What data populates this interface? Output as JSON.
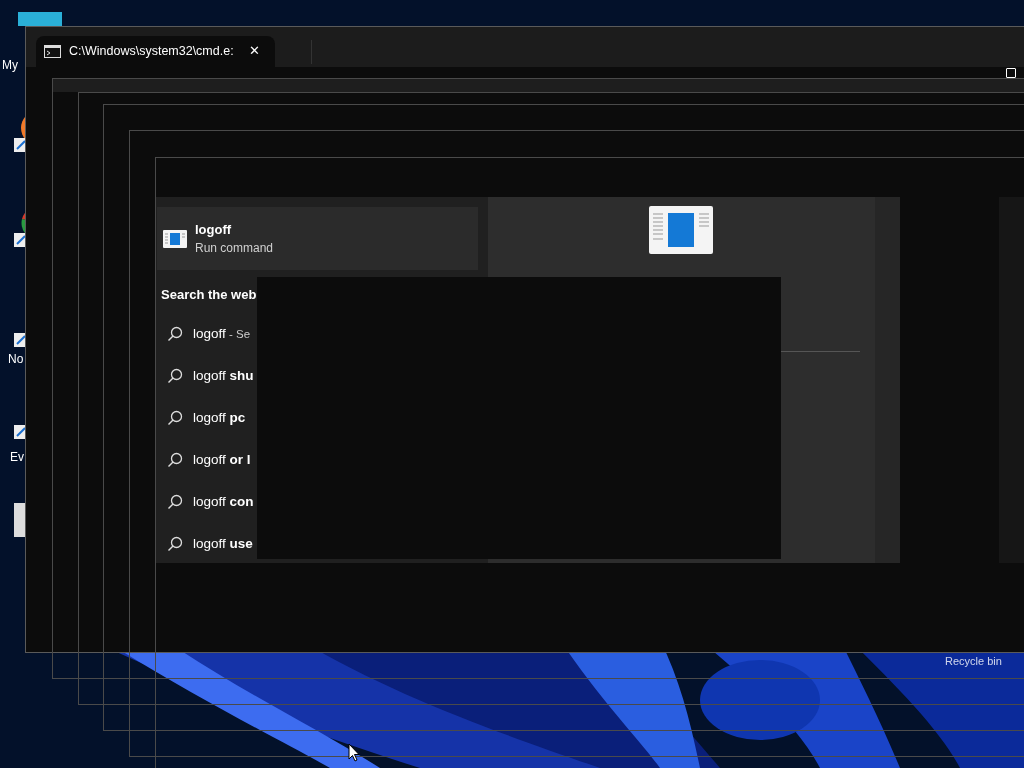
{
  "desktop_icons": [
    {
      "kind": "monitor",
      "label": "My"
    },
    {
      "kind": "orange"
    },
    {
      "kind": "chrome"
    },
    {
      "kind": "notepad",
      "label": "No"
    },
    {
      "kind": "shortcut",
      "label": "Ev"
    },
    {
      "kind": "blank"
    }
  ],
  "recycle_bin": {
    "label": "Recycle bin"
  },
  "window": {
    "tab_title": "C:\\Windows\\system32\\cmd.e:",
    "close": "✕"
  },
  "best_match": {
    "title": "logoff",
    "subtitle": "Run command"
  },
  "web_section": {
    "heading": "Search the web",
    "results": [
      {
        "text": "logoff",
        "suffix": "- Se"
      },
      {
        "text": "logoff **shu**"
      },
      {
        "text": "logoff **pc**"
      },
      {
        "text": "logoff **or l**"
      },
      {
        "text": "logoff **con**"
      },
      {
        "text": "logoff **use**"
      }
    ]
  }
}
